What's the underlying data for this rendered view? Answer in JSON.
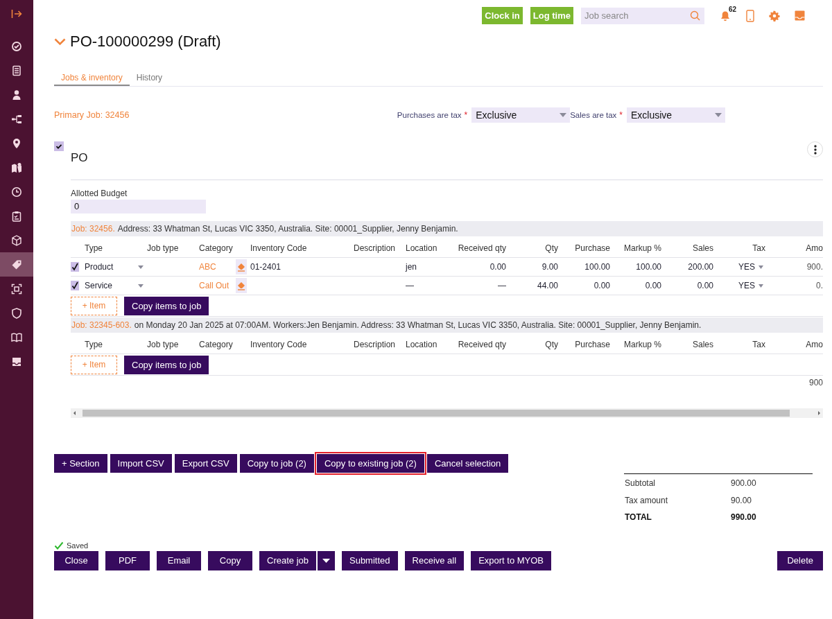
{
  "sidebar": {
    "items": [
      {
        "selected": false
      },
      {
        "selected": false
      },
      {
        "selected": false
      },
      {
        "selected": false
      },
      {
        "selected": false
      },
      {
        "selected": false
      },
      {
        "selected": false
      },
      {
        "selected": false
      },
      {
        "selected": false
      },
      {
        "selected": true
      },
      {
        "selected": false
      },
      {
        "selected": false
      },
      {
        "selected": false
      },
      {
        "selected": false
      }
    ]
  },
  "topbar": {
    "buttons": [
      "Clock in",
      "Log time"
    ],
    "search": {
      "placeholder": "Job search"
    },
    "notification_count": "62"
  },
  "header": {
    "title": "PO-100000299 (Draft)",
    "expanded": true,
    "tabs": [
      {
        "label": "Jobs & inventory",
        "selected": true
      },
      {
        "label": "History",
        "selected": false
      }
    ],
    "primary_job": "Primary Job: 32456",
    "tax_fields": [
      {
        "label": "Purchases are tax",
        "required_mark": "*",
        "value": "Exclusive"
      },
      {
        "label": "Sales are tax",
        "required_mark": "*",
        "value": "Exclusive"
      }
    ]
  },
  "section": {
    "checked": true,
    "title": "PO",
    "budget": {
      "label": "Allotted Budget",
      "value": "0"
    },
    "jobs": [
      {
        "job_ref": "Job: 32456.",
        "details": "Address: 33 Whatman St, Lucas VIC 3350, Australia. Site: 00001_Supplier, Jenny Benjamin.",
        "columns": [
          "Type",
          "Job type",
          "Category",
          "Inventory Code",
          "Description",
          "Location",
          "Received qty",
          "Qty",
          "Purchase",
          "Markup %",
          "Sales",
          "Tax",
          "Amo"
        ],
        "rows": [
          {
            "checked": true,
            "type": "Product",
            "category": "ABC",
            "inventory_code": "01-2401",
            "location": "jen",
            "received_qty": "0.00",
            "qty": "9.00",
            "purchase": "100.00",
            "markup": "100.00",
            "sales": "200.00",
            "tax": "YES",
            "amount": "900."
          },
          {
            "checked": true,
            "type": "Service",
            "category": "Call Out",
            "location": "—",
            "received_qty": "—",
            "qty": "44.00",
            "purchase": "0.00",
            "markup": "0.00",
            "sales": "0.00",
            "tax": "YES",
            "amount": "0."
          }
        ],
        "add_item": "+ Item",
        "copy_button": "Copy items to job"
      },
      {
        "job_ref": "Job: 32345-603.",
        "details": "on Monday 20 Jan 2025 at 07:00AM. Workers:Jen Benjamin. Address: 33 Whatman St, Lucas VIC 3350, Australia. Site: 00001_Supplier, Jenny Benjamin.",
        "columns": [
          "Type",
          "Job type",
          "Category",
          "Inventory Code",
          "Description",
          "Location",
          "Received qty",
          "Qty",
          "Purchase",
          "Markup %",
          "Sales",
          "Tax",
          "Amo"
        ],
        "add_item": "+ Item",
        "copy_button": "Copy items to job"
      }
    ],
    "amount_total": "900"
  },
  "section_buttons": [
    {
      "label": "+ Section",
      "highlighted": false
    },
    {
      "label": "Import CSV",
      "highlighted": false
    },
    {
      "label": "Export CSV",
      "highlighted": false
    },
    {
      "label": "Copy to job (2)",
      "highlighted": false
    },
    {
      "label": "Copy to existing job (2)",
      "highlighted": true
    },
    {
      "label": "Cancel selection",
      "highlighted": false
    }
  ],
  "totals": [
    {
      "label": "Subtotal",
      "value": "900.00",
      "kind": "normal"
    },
    {
      "label": "Tax amount",
      "value": "90.00",
      "kind": "normal"
    },
    {
      "label": "TOTAL",
      "value": "990.00",
      "kind": "grand"
    }
  ],
  "status": {
    "saved": true,
    "text": "Saved"
  },
  "footer_buttons": [
    {
      "label": "Close",
      "kind": "plain"
    },
    {
      "label": "PDF",
      "kind": "plain"
    },
    {
      "label": "Email",
      "kind": "plain"
    },
    {
      "label": "Copy",
      "kind": "plain"
    },
    {
      "label": "Create job",
      "kind": "split"
    },
    {
      "label": "Submitted",
      "kind": "plain"
    },
    {
      "label": "Receive all",
      "kind": "plain"
    },
    {
      "label": "Export to MYOB",
      "kind": "plain"
    }
  ],
  "delete_button": "Delete"
}
